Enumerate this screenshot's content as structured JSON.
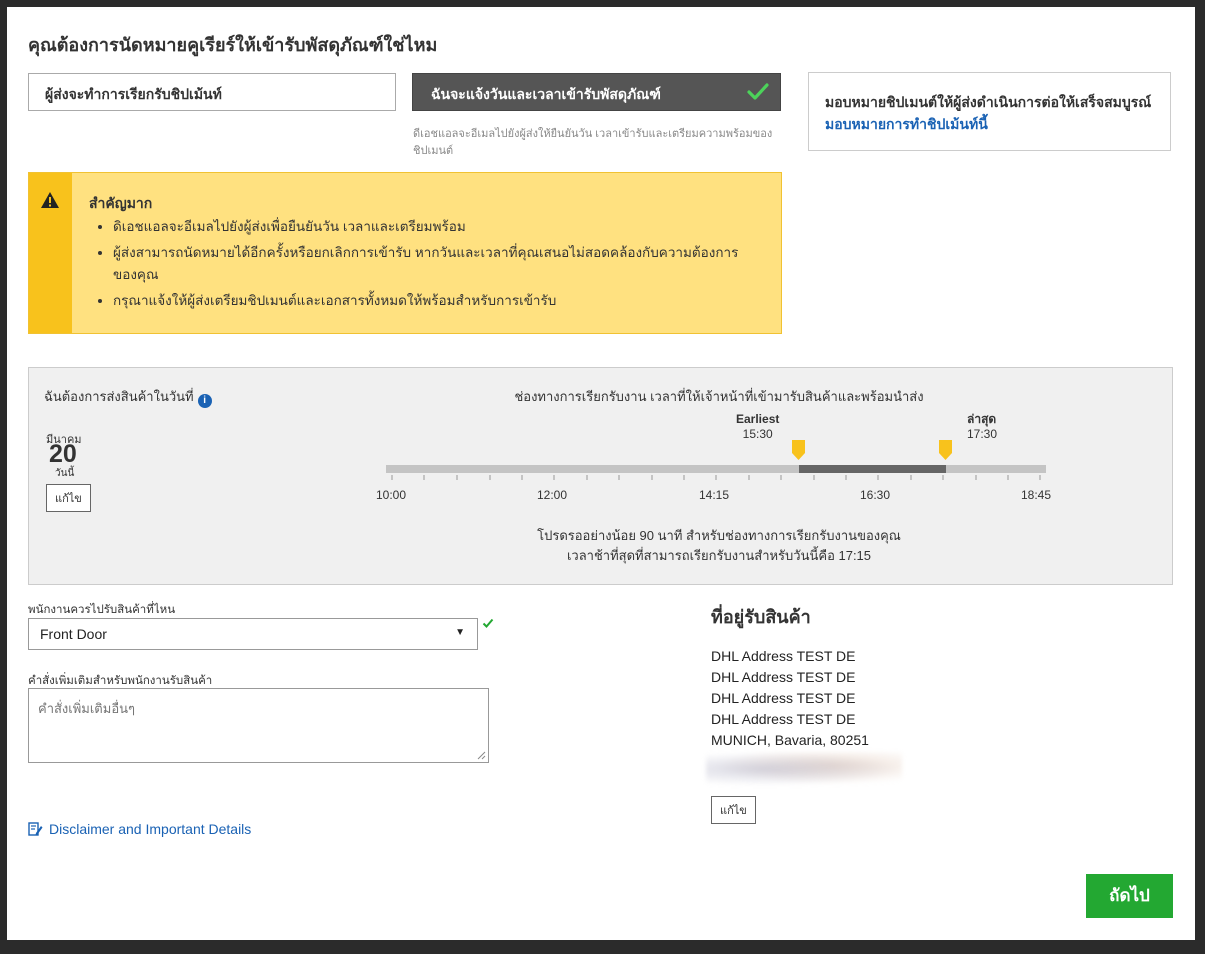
{
  "page": {
    "title": "คุณต้องการนัดหมายคูเรียร์ให้เข้ารับพัสดุภัณฑ์ใช่ไหม"
  },
  "options": {
    "shipper_schedules": "ผู้ส่งจะทำการเรียกรับชิปเม้นท์",
    "i_schedule": "ฉันจะแจ้งวันและเวลาเข้ารับพัสดุภัณฑ์",
    "i_schedule_sub": "ดีเอชแอลจะอีเมลไปยังผู้ส่งให้ยืนยันวัน เวลาเข้ารับและเตรียมความพร้อมของชิปเมนต์",
    "selected_color": "#555555",
    "check_color": "#4cd35a"
  },
  "delegate": {
    "text": "มอบหมายชิปเมนต์ให้ผู้ส่งดำเนินการต่อให้เสร็จสมบูรณ์",
    "link": "มอบหมายการทำชิปเม้นท์นี้"
  },
  "warning": {
    "icon": "warning-triangle-icon",
    "title": "สำคัญมาก",
    "items": [
      "ดิเอชแอลจะอีเมลไปยังผู้ส่งเพื่อยืนยันวัน เวลาและเตรียมพร้อม",
      "ผู้ส่งสามารถนัดหมายได้อีกครั้งหรือยกเลิกการเข้ารับ หากวันและเวลาที่คุณเสนอไม่สอดคล้องกับความต้องการของคุณ",
      "กรุณาแจ้งให้ผู้ส่งเตรียมชิปเมนต์และเอกสารทั้งหมดให้พร้อมสำหรับการเข้ารับ"
    ]
  },
  "pickup": {
    "date_label": "ฉันต้องการส่งสินค้าในวันที่",
    "month": "มีนาคม",
    "day": "20",
    "today": "วันนี้",
    "edit": "แก้ไข",
    "window_header": "ช่องทางการเรียกรับงาน เวลาที่ให้เจ้าหน้าที่เข้ามารับสินค้าและพร้อมนำส่ง",
    "earliest_label": "Earliest",
    "earliest_time": "15:30",
    "latest_label": "ล่าสุด",
    "latest_time": "17:30",
    "ticks": [
      "10:00",
      "12:00",
      "14:15",
      "16:30",
      "18:45"
    ],
    "note_line1": "โปรดรออย่างน้อย 90 นาที สำหรับช่องทางการเรียกรับงานของคุณ",
    "note_line2": "เวลาช้าที่สุดที่สามารถเรียกรับงานสำหรับวันนี้คือ 17:15",
    "marker_color": "#f8c21c"
  },
  "location": {
    "label": "พนักงานควรไปรับสินค้าที่ไหน",
    "value": "Front Door"
  },
  "instructions": {
    "label": "คำสั่งเพิ่มเติมสำหรับพนักงานรับสินค้า",
    "placeholder": "คำสั่งเพิ่มเติมอื่นๆ"
  },
  "disclaimer": {
    "text": "Disclaimer and Important Details"
  },
  "address": {
    "heading": "ที่อยู่รับสินค้า",
    "lines": [
      "DHL Address TEST DE",
      "DHL Address TEST DE",
      "DHL Address TEST DE",
      "DHL Address TEST DE",
      "MUNICH, Bavaria, 80251"
    ],
    "edit": "แก้ไข"
  },
  "next": {
    "label": "ถัดไป",
    "color": "#23a832"
  }
}
